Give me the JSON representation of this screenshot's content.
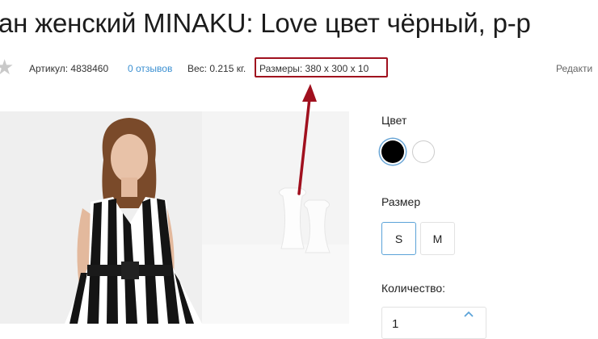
{
  "product": {
    "title": "ан женский MINAKU: Love цвет чёрный, р-р"
  },
  "meta": {
    "article": "Артикул: 4838460",
    "reviews": "0 отзывов",
    "weight": "Вес: 0.215 кг.",
    "dimensions": "Размеры: 380 x 300 x 10",
    "edit": "Редакти"
  },
  "options": {
    "color_label": "Цвет",
    "colors": [
      {
        "name": "black",
        "hex": "#000000"
      },
      {
        "name": "white",
        "hex": "#ffffff"
      }
    ],
    "size_label": "Размер",
    "sizes": [
      "S",
      "M"
    ],
    "selected_size": "S",
    "quantity_label": "Количество:",
    "quantity": "1"
  },
  "colors": {
    "highlight": "#a0101e",
    "link": "#3a8fd1",
    "selected_border": "#5ba3d8",
    "rating_star": "#c9c9c9"
  },
  "icons": {
    "rating": "star-icon",
    "annotation": "red-arrow-icon",
    "increment": "chevron-up-icon"
  }
}
